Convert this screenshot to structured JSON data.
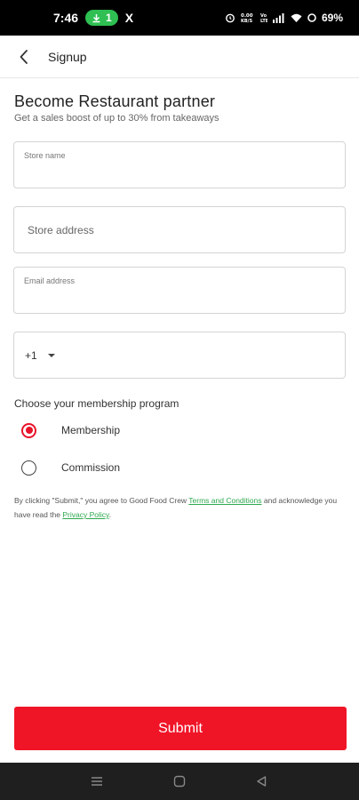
{
  "status_bar": {
    "time": "7:46",
    "pill_count": "1",
    "app_icon": "X",
    "network_speed": "0.00\nKB/S",
    "signal_labels": "Vo LTE",
    "battery": "69%"
  },
  "header": {
    "title": "Signup",
    "back_icon": "chevron-left-icon"
  },
  "form": {
    "title": "Become Restaurant partner",
    "subtitle": "Get a sales boost of up to 30% from takeaways",
    "store_name_label": "Store name",
    "store_address_placeholder": "Store address",
    "email_label": "Email address",
    "phone_code": "+1",
    "membership_label": "Choose your membership program",
    "options": [
      {
        "label": "Membership",
        "selected": true
      },
      {
        "label": "Commission",
        "selected": false
      }
    ],
    "terms_prefix": "By clicking \"Submit,\" you agree to Good Food Crew",
    "terms_link": "Terms and Conditions",
    "terms_middle": "and acknowledge you have read the",
    "privacy_link": "Privacy Policy",
    "terms_suffix": ".",
    "submit_label": "Submit"
  },
  "colors": {
    "accent": "#f01427",
    "link": "#2fa84f",
    "status_pill": "#2fbf52"
  }
}
